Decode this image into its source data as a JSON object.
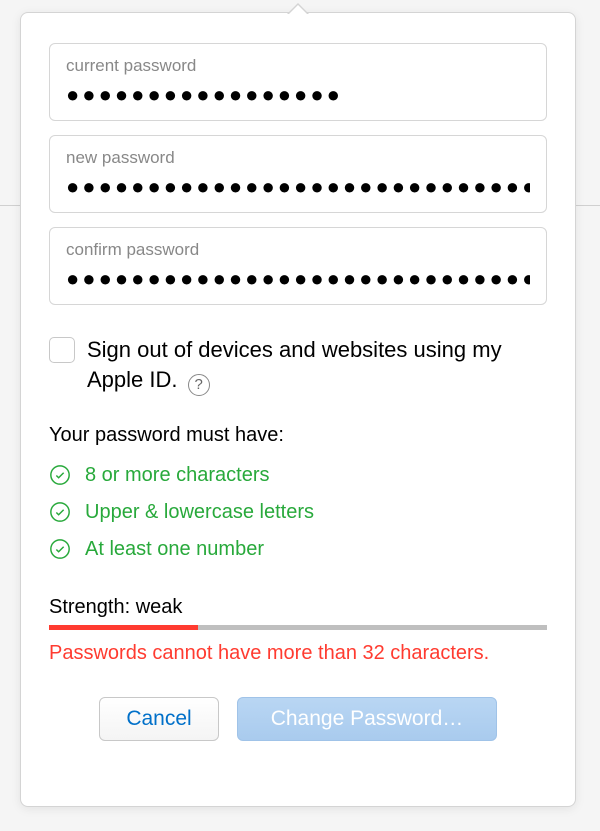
{
  "fields": {
    "current": {
      "label": "current password",
      "mask": "●●●●●●●●●●●●●●●●●"
    },
    "new": {
      "label": "new password",
      "mask": "●●●●●●●●●●●●●●●●●●●●●●●●●●●●●●●●●●●"
    },
    "confirm": {
      "label": "confirm password",
      "mask": "●●●●●●●●●●●●●●●●●●●●●●●●●●●●●●●●●●●"
    }
  },
  "signout": {
    "label": "Sign out of devices and websites using my Apple ID.",
    "checked": false
  },
  "requirements": {
    "title": "Your password must have:",
    "items": [
      "8 or more characters",
      "Upper & lowercase letters",
      "At least one number"
    ]
  },
  "strength": {
    "label": "Strength: weak",
    "percent": 30,
    "fill_color": "#ff3b30"
  },
  "error": "Passwords cannot have more than 32 characters.",
  "buttons": {
    "cancel": "Cancel",
    "submit": "Change Password…"
  }
}
